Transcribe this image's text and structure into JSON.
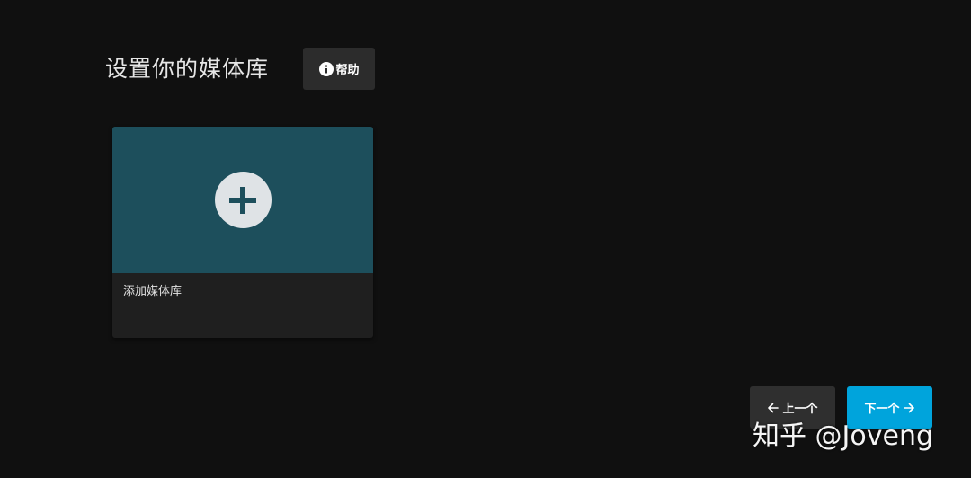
{
  "header": {
    "title": "设置你的媒体库",
    "help_label": "帮助"
  },
  "library": {
    "add_label": "添加媒体库"
  },
  "navigation": {
    "previous_label": "上一个",
    "next_label": "下一个"
  },
  "watermark": {
    "text": "知乎 @Joveng"
  },
  "colors": {
    "background": "#101010",
    "card_image": "#1d4f5c",
    "accent": "#00a4dc"
  }
}
